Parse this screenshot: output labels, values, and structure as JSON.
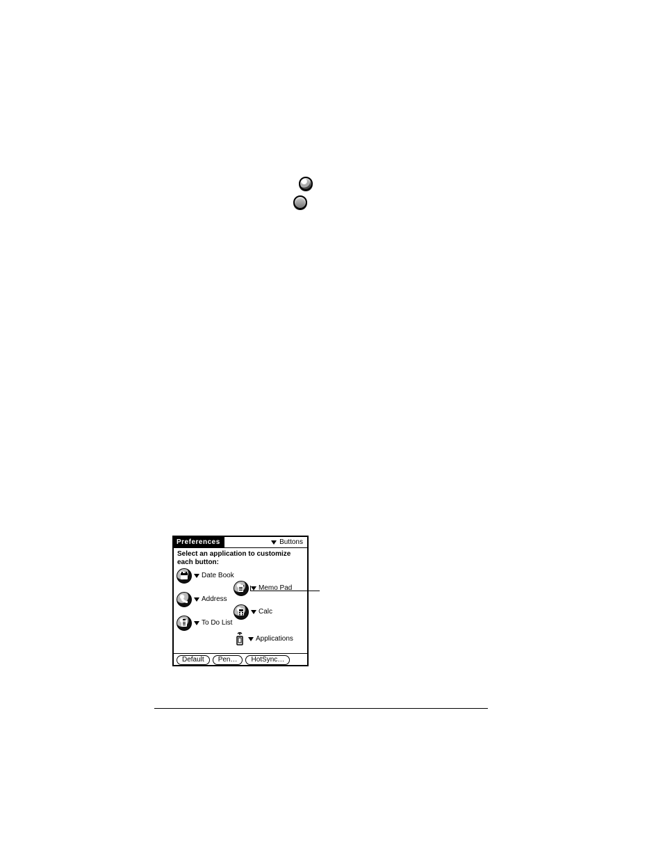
{
  "icons": {
    "house_alt": "Applications soft button icon",
    "printer_alt": "HotSync icon"
  },
  "prefs": {
    "title": "Preferences",
    "category": "Buttons",
    "instructions": "Select an application to customize each button:",
    "slots": {
      "left": [
        {
          "label": "Date Book"
        },
        {
          "label": "Address"
        },
        {
          "label": "To Do List"
        }
      ],
      "right": [
        {
          "label": "Memo Pad"
        },
        {
          "label": "Calc"
        },
        {
          "label": "Applications"
        }
      ]
    },
    "buttons": {
      "default": "Default",
      "pen": "Pen…",
      "hotsync": "HotSync…"
    }
  }
}
